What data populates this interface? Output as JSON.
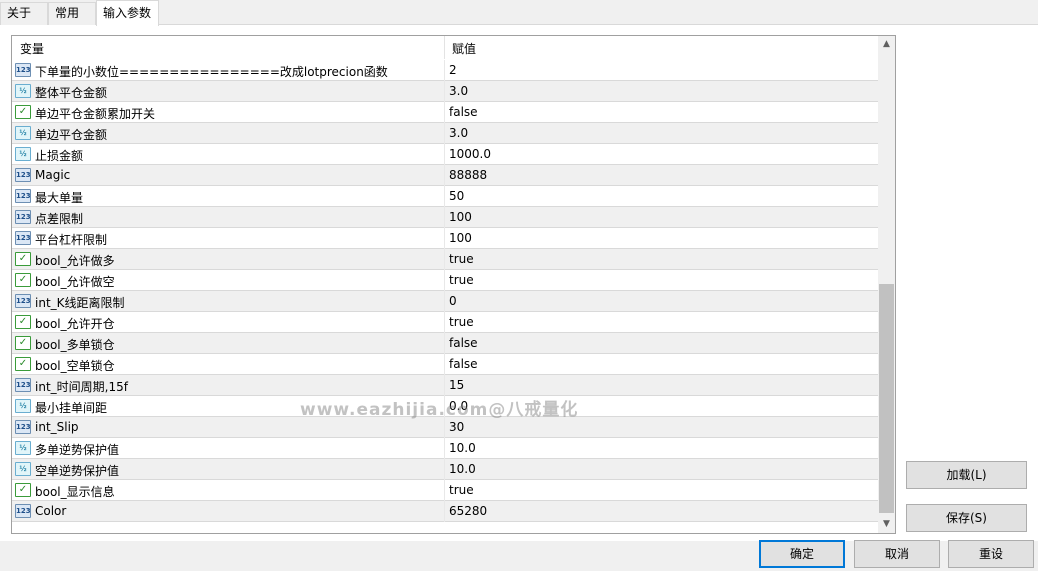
{
  "tabs": [
    {
      "label": "关于",
      "active": false
    },
    {
      "label": "常用",
      "active": false
    },
    {
      "label": "输入参数",
      "active": true
    }
  ],
  "grid": {
    "headers": {
      "variable": "变量",
      "value": "赋值"
    },
    "rows": [
      {
        "type": "int",
        "icon": "123",
        "name": "下单量的小数位================改成lotprecion函数",
        "value": "2"
      },
      {
        "type": "double",
        "icon": "½",
        "name": "整体平仓金额",
        "value": "3.0"
      },
      {
        "type": "bool",
        "icon": "✓",
        "name": "单边平仓金额累加开关",
        "value": "false"
      },
      {
        "type": "double",
        "icon": "½",
        "name": "单边平仓金额",
        "value": "3.0"
      },
      {
        "type": "double",
        "icon": "½",
        "name": "止损金额",
        "value": "1000.0"
      },
      {
        "type": "int",
        "icon": "123",
        "name": "Magic",
        "value": "88888"
      },
      {
        "type": "int",
        "icon": "123",
        "name": "最大单量",
        "value": "50"
      },
      {
        "type": "int",
        "icon": "123",
        "name": "点差限制",
        "value": "100"
      },
      {
        "type": "int",
        "icon": "123",
        "name": "平台杠杆限制",
        "value": "100"
      },
      {
        "type": "bool",
        "icon": "✓",
        "name": "bool_允许做多",
        "value": "true"
      },
      {
        "type": "bool",
        "icon": "✓",
        "name": "bool_允许做空",
        "value": "true"
      },
      {
        "type": "int",
        "icon": "123",
        "name": "int_K线距离限制",
        "value": "0"
      },
      {
        "type": "bool",
        "icon": "✓",
        "name": "bool_允许开仓",
        "value": "true"
      },
      {
        "type": "bool",
        "icon": "✓",
        "name": "bool_多单锁仓",
        "value": "false"
      },
      {
        "type": "bool",
        "icon": "✓",
        "name": "bool_空单锁仓",
        "value": "false"
      },
      {
        "type": "int",
        "icon": "123",
        "name": "int_时间周期,15f",
        "value": "15"
      },
      {
        "type": "double",
        "icon": "½",
        "name": "最小挂单间距",
        "value": "0.0"
      },
      {
        "type": "int",
        "icon": "123",
        "name": "int_Slip",
        "value": "30"
      },
      {
        "type": "double",
        "icon": "½",
        "name": "多单逆势保护值",
        "value": "10.0"
      },
      {
        "type": "double",
        "icon": "½",
        "name": "空单逆势保护值",
        "value": "10.0"
      },
      {
        "type": "bool",
        "icon": "✓",
        "name": "bool_显示信息",
        "value": "true"
      },
      {
        "type": "color",
        "icon": "123",
        "name": "Color",
        "value": "65280"
      }
    ]
  },
  "scrollbar": {
    "up_glyph": "▲",
    "down_glyph": "▼"
  },
  "buttons": {
    "load": "加载(L)",
    "save": "保存(S)",
    "ok": "确定",
    "cancel": "取消",
    "reset": "重设"
  },
  "watermark": "www.eazhijia.com@八戒量化",
  "colors": {
    "default_button_border": "#0078d7",
    "row_alt": "#f0f0f0",
    "scroll_thumb": "#c1c1c1"
  }
}
